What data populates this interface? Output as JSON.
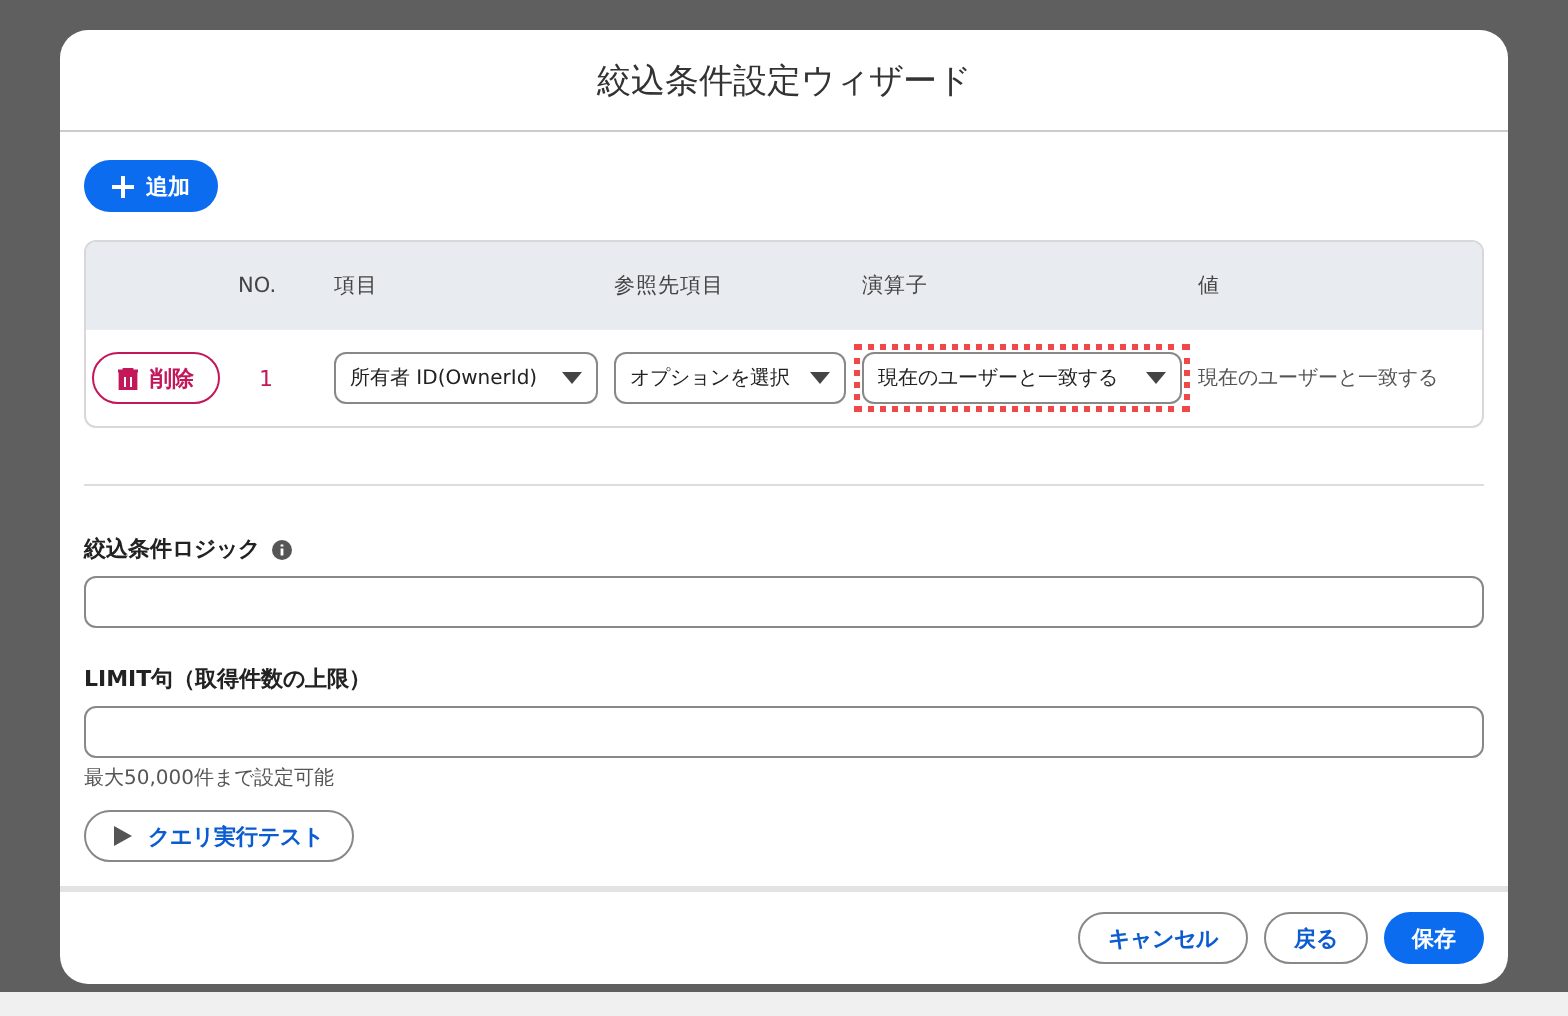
{
  "dialog": {
    "title": "絞込条件設定ウィザード"
  },
  "add_button": {
    "label": "追加"
  },
  "table": {
    "columns": [
      "NO.",
      "項目",
      "参照先項目",
      "演算子",
      "値"
    ],
    "rows": [
      {
        "delete_label": "削除",
        "no": "1",
        "field": "所有者 ID(OwnerId)",
        "reference": "オプションを選択",
        "operator": "現在のユーザーと一致する",
        "operator_highlighted": true,
        "value": "現在のユーザーと一致する"
      }
    ]
  },
  "logic": {
    "label": "絞込条件ロジック"
  },
  "limit": {
    "label": "LIMIT句（取得件数の上限）",
    "help": "最大50,000件まで設定可能"
  },
  "test_button": {
    "label": "クエリ実行テスト"
  },
  "footer": {
    "buttons": [
      {
        "label": "キャンセル",
        "kind": "outline"
      },
      {
        "label": "戻る",
        "kind": "outline"
      },
      {
        "label": "保存",
        "kind": "primary"
      }
    ]
  }
}
